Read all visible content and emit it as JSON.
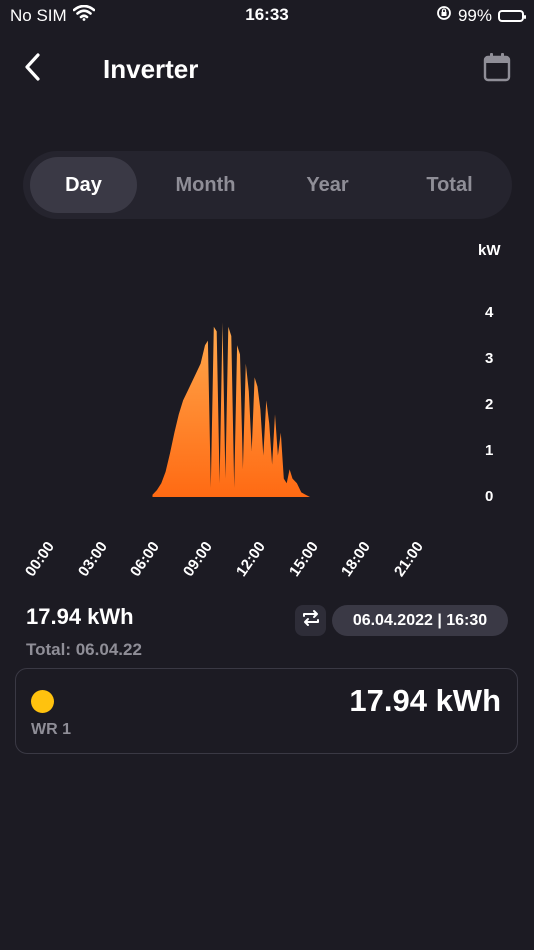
{
  "status_bar": {
    "carrier": "No SIM",
    "time": "16:33",
    "battery": "99%",
    "battery_color": "#ffc700"
  },
  "header": {
    "title": "Inverter",
    "back_icon": "chevron-left-icon",
    "calendar_icon": "calendar-icon"
  },
  "tabs": [
    {
      "label": "Day",
      "active": true
    },
    {
      "label": "Month",
      "active": false
    },
    {
      "label": "Year",
      "active": false
    },
    {
      "label": "Total",
      "active": false
    }
  ],
  "chart_data": {
    "type": "area",
    "ylabel": "kW",
    "yticks": [
      "4",
      "3",
      "2",
      "1",
      "0"
    ],
    "ylim": [
      0,
      4
    ],
    "xticks": [
      "00:00",
      "03:00",
      "06:00",
      "09:00",
      "12:00",
      "15:00",
      "18:00",
      "21:00"
    ],
    "fill_top_color": "#ffa94d",
    "fill_bottom_color": "#ff6a13",
    "series": [
      {
        "x": [
          "07:00",
          "07:15",
          "07:30",
          "07:45",
          "08:00",
          "08:15",
          "08:30",
          "08:45",
          "09:00",
          "09:15",
          "09:30",
          "09:45",
          "10:00",
          "10:10",
          "10:20",
          "10:30",
          "10:40",
          "10:50",
          "11:00",
          "11:10",
          "11:20",
          "11:30",
          "11:40",
          "11:50",
          "12:00",
          "12:10",
          "12:20",
          "12:30",
          "12:40",
          "12:50",
          "13:00",
          "13:10",
          "13:20",
          "13:30",
          "13:40",
          "13:50",
          "14:00",
          "14:10",
          "14:20",
          "14:30",
          "14:40",
          "14:50",
          "15:00",
          "15:15",
          "15:30",
          "15:45",
          "16:00",
          "16:15",
          "16:30",
          "16:45",
          "17:00",
          "17:15",
          "17:30",
          "17:45",
          "18:00",
          "18:15",
          "18:30",
          "18:45",
          "19:00"
        ],
        "values": [
          0.05,
          0.15,
          0.3,
          0.55,
          0.95,
          1.4,
          1.8,
          2.1,
          2.3,
          2.5,
          2.7,
          2.9,
          3.3,
          3.4,
          0.2,
          3.7,
          3.6,
          0.3,
          3.8,
          0.4,
          3.7,
          3.5,
          0.2,
          3.3,
          3.1,
          0.6,
          2.9,
          2.3,
          1.0,
          2.6,
          2.4,
          1.9,
          0.9,
          2.1,
          1.6,
          0.7,
          1.8,
          0.9,
          1.4,
          0.4,
          0.3,
          0.6,
          0.4,
          0.3,
          0.1,
          0.05,
          0.0,
          0.0,
          0.0,
          0.0,
          0.0,
          0.0,
          0.0,
          0.0,
          0.0,
          0.0,
          0.0,
          0.0,
          0.0
        ]
      }
    ]
  },
  "summary": {
    "energy": "17.94 kWh",
    "total": "Total: 06.04.22",
    "timestamp": "06.04.2022 | 16:30",
    "swap_icon": "swap-arrows-icon"
  },
  "inverter_card": {
    "label": "WR 1",
    "value": "17.94 kWh",
    "dot_color": "#ffc20e"
  }
}
